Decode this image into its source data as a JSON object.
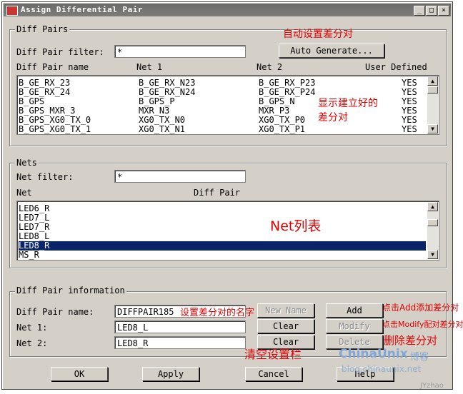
{
  "window": {
    "title": "Assign Differential Pair",
    "controls": [
      "_",
      "□",
      "×"
    ]
  },
  "diff_pairs": {
    "group_label": "Diff Pairs",
    "filter_label": "Diff Pair filter:",
    "filter_value": "*",
    "auto_generate_label": "Auto Generate...",
    "columns": [
      "Diff Pair name",
      "Net 1",
      "Net 2",
      "User Defined"
    ],
    "rows": [
      {
        "name": "B_GE_RX_23",
        "net1": "B_GE_RX_N23",
        "net2": "B_GE_RX_P23",
        "user": "YES"
      },
      {
        "name": "B_GE_RX_24",
        "net1": "B_GE_RX_N24",
        "net2": "B_GE_RX_P24",
        "user": "YES"
      },
      {
        "name": "B_GPS",
        "net1": "B_GPS_P",
        "net2": "B_GPS_N",
        "user": "YES"
      },
      {
        "name": "B_GPS_MXR_3",
        "net1": "MXR_N3",
        "net2": "MXR_P3",
        "user": "YES"
      },
      {
        "name": "B_GPS_XG0_TX_0",
        "net1": "XG0_TX_N0",
        "net2": "XG0_TX_P0",
        "user": "YES"
      },
      {
        "name": "B_GPS_XG0_TX_1",
        "net1": "XG0_TX_N1",
        "net2": "XG0_TX_P1",
        "user": "YES"
      }
    ]
  },
  "nets": {
    "group_label": "Nets",
    "filter_label": "Net filter:",
    "filter_value": "*",
    "columns": [
      "Net",
      "Diff Pair"
    ],
    "rows": [
      "LED6_R",
      "LED7_L",
      "LED7_R",
      "LED8_L",
      "LED8_R",
      "MS_R"
    ],
    "selected_index": 4
  },
  "info": {
    "group_label": "Diff Pair information",
    "name_label": "Diff Pair name:",
    "name_value": "DIFFPAIR185",
    "net1_label": "Net 1:",
    "net1_value": "LED8_L",
    "net2_label": "Net 2:",
    "net2_value": "LED8_R",
    "new_name_label": "New Name",
    "add_label": "Add",
    "modify_label": "Modify",
    "delete_label": "Delete",
    "clear1_label": "Clear",
    "clear2_label": "Clear"
  },
  "footer": {
    "ok_label": "OK",
    "apply_label": "Apply",
    "cancel_label": "Cancel",
    "help_label": "Help"
  },
  "annotations": {
    "auto_generate": "自动设置差分对",
    "show_pairs_line1": "显示建立好的",
    "show_pairs_line2": "差分对",
    "net_list": "Net列表",
    "set_name": "设置差分对的名字",
    "add_hint": "点击Add添加差分对",
    "modify_hint": "点击Modify配对差分对",
    "delete_hint": "删除差分对",
    "clear_hint": "清空设置栏"
  },
  "watermark": {
    "brand": "ChinaUnix",
    "brand_cn": "博客",
    "url": "blog.chinaunix.net",
    "author": "JYzhao"
  },
  "colors": {
    "window_bg": "#d4d0c8",
    "selection": "#0a246a",
    "annotation": "#e00000"
  }
}
